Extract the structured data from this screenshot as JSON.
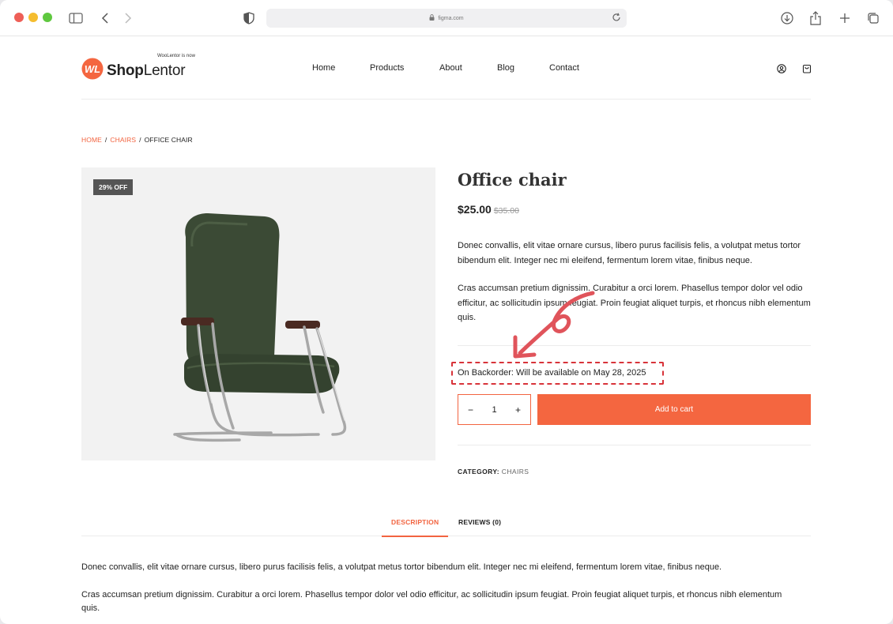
{
  "browser": {
    "url": "figma.com"
  },
  "header": {
    "logo_tagline": "WooLentor is now",
    "logo_bold": "Shop",
    "logo_light": "Lentor",
    "nav": [
      "Home",
      "Products",
      "About",
      "Blog",
      "Contact"
    ]
  },
  "breadcrumb": {
    "home": "HOME",
    "category": "CHAIRS",
    "current": "OFFICE CHAIR",
    "separator": "/"
  },
  "product": {
    "badge": "29% OFF",
    "title": "Office chair",
    "price_now": "$25.00",
    "price_was": "$35.00",
    "short_desc_1": "Donec convallis, elit vitae ornare cursus, libero purus facilisis felis, a volutpat metus tortor bibendum elit. Integer nec mi eleifend, fermentum lorem vitae, finibus neque.",
    "short_desc_2": "Cras accumsan pretium dignissim. Curabitur a orci lorem. Phasellus tempor dolor vel odio efficitur, ac sollicitudin ipsum feugiat. Proin feugiat aliquet turpis, et rhoncus nibh elementum quis.",
    "backorder": "On Backorder: Will be available on May 28, 2025",
    "qty_minus": "−",
    "qty_value": "1",
    "qty_plus": "+",
    "add_to_cart": "Add to cart",
    "category_label": "CATEGORY:",
    "category_value": "CHAIRS"
  },
  "tabs": {
    "description": "DESCRIPTION",
    "reviews": "REVIEWS (0)"
  },
  "long_description": {
    "p1": "Donec convallis, elit vitae ornare cursus, libero purus facilisis felis, a volutpat metus tortor bibendum elit. Integer nec mi eleifend, fermentum lorem vitae, finibus neque.",
    "p2": "Cras accumsan pretium dignissim. Curabitur a orci lorem. Phasellus tempor dolor vel odio efficitur, ac sollicitudin ipsum feugiat. Proin feugiat aliquet turpis, et rhoncus nibh elementum quis."
  },
  "colors": {
    "accent": "#f46640",
    "annotation": "#d8333a",
    "chair_green": "#3b4a35"
  },
  "icons": [
    "sidebar-icon",
    "back-icon",
    "forward-icon",
    "shield-icon",
    "lock-icon",
    "reload-icon",
    "download-icon",
    "share-icon",
    "new-tab-icon",
    "tabs-icon",
    "account-icon",
    "cart-icon"
  ]
}
